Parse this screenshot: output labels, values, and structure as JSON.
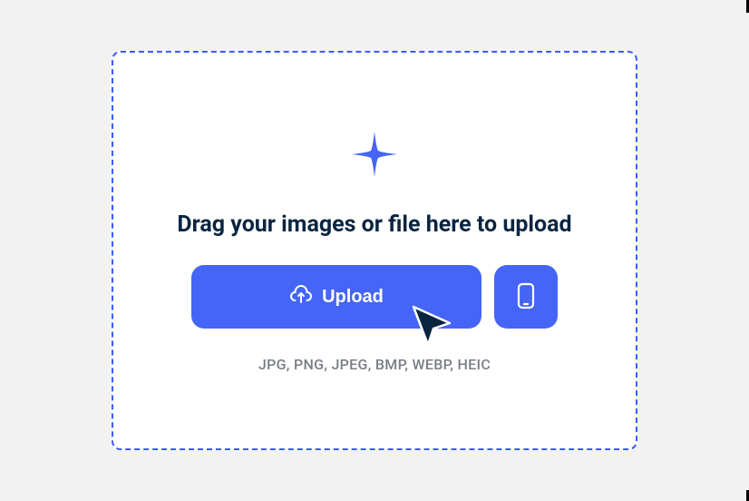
{
  "dropzone": {
    "heading": "Drag your images or file here to upload",
    "upload_label": "Upload",
    "formats": "JPG, PNG, JPEG, BMP, WEBP, HEIC",
    "colors": {
      "accent": "#4565f6",
      "border": "#3b5cff",
      "text_dark": "#0a2540",
      "text_muted": "#7a7d85"
    }
  }
}
